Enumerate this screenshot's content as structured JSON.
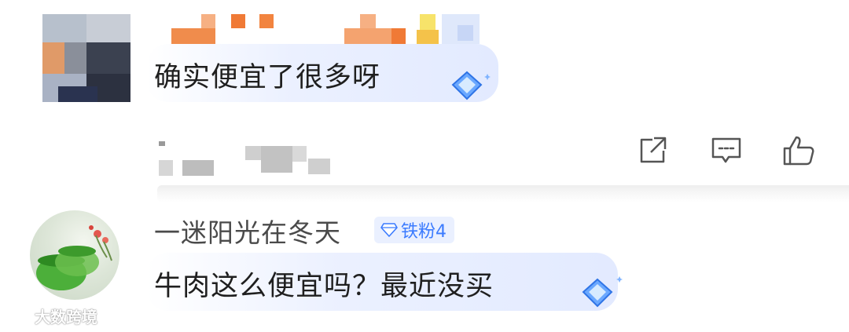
{
  "comments": [
    {
      "text": "确实便宜了很多呀",
      "badge_icon": "blue-diamond-icon"
    },
    {
      "username": "一迷阳光在冬天",
      "fan_badge": "铁粉4",
      "text": "牛肉这么便宜吗？最近没买",
      "badge_icon": "blue-diamond-icon"
    }
  ],
  "actions": {
    "share_icon": "share-icon",
    "reply_icon": "comment-icon",
    "like_icon": "thumbs-up-icon"
  },
  "watermark": {
    "text": "大数跨境"
  },
  "colors": {
    "accent_blue": "#3b7bff",
    "badge_bg": "#eaf0ff",
    "bubble_bg": "#e6ecff"
  }
}
